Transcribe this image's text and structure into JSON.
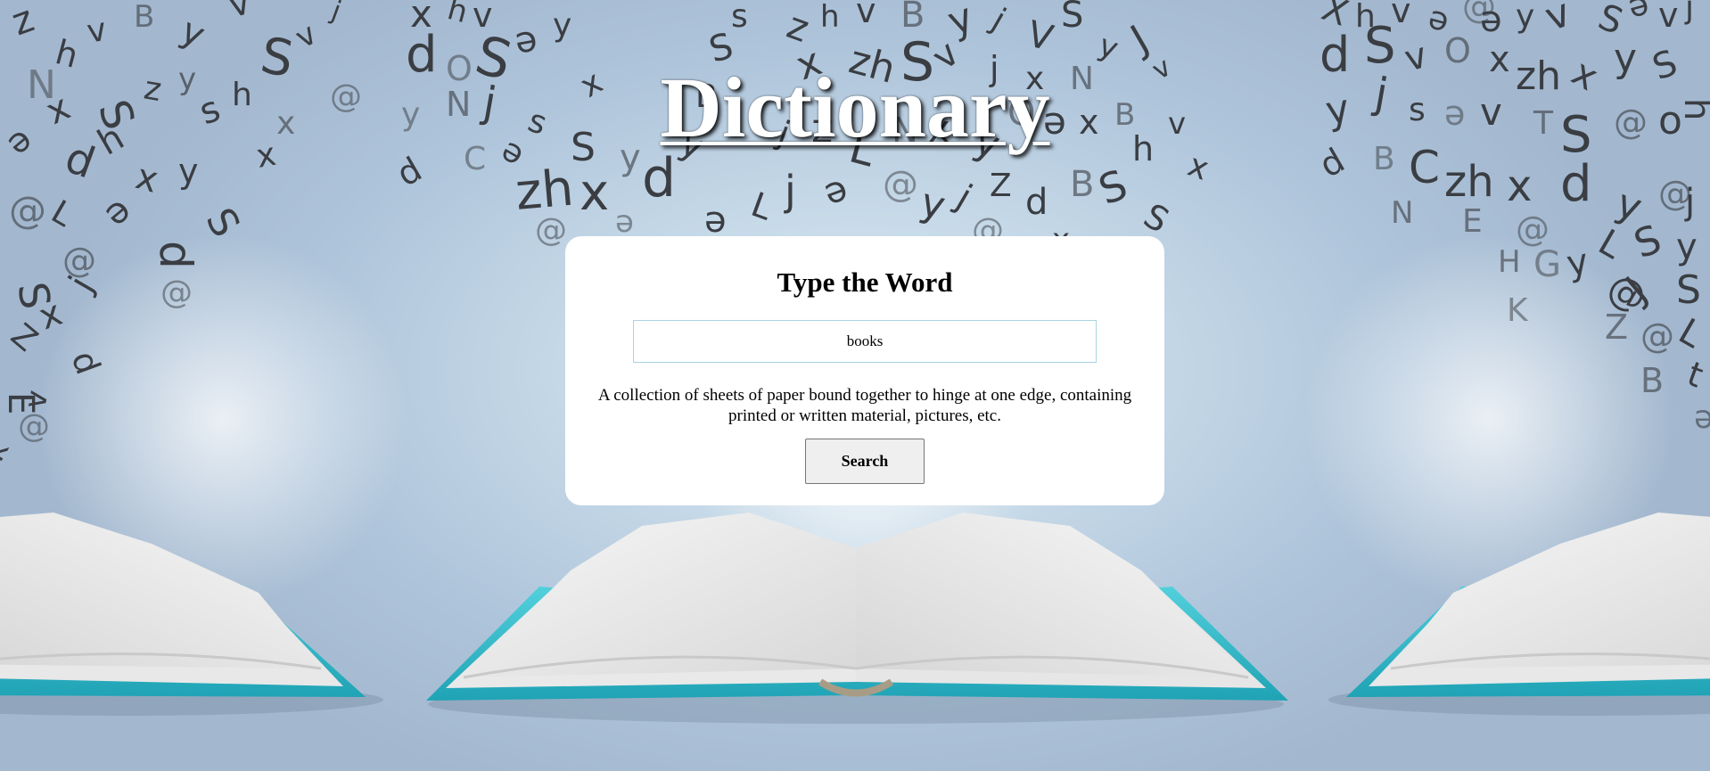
{
  "app": {
    "title": "Dictionary"
  },
  "search_card": {
    "heading": "Type the Word",
    "input_value": "books",
    "definition": "A collection of sheets of paper bound together to hinge at one edge, containing printed or written material, pictures, etc.",
    "button_label": "Search"
  },
  "colors": {
    "background": "#aec4da",
    "book_cover": "#3cc1cf",
    "card": "#ffffff",
    "title_text": "#ffffff",
    "input_border": "#a9d3e3"
  },
  "decor": {
    "background_icon": "scattered-letters-and-open-books-icon"
  }
}
